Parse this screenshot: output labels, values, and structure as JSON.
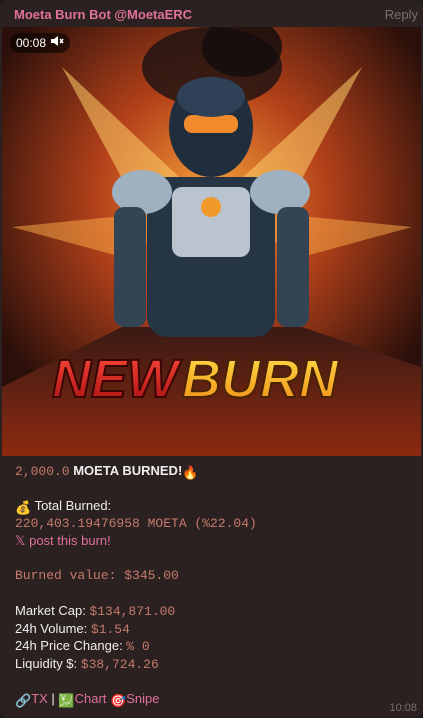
{
  "header": {
    "sender": "Moeta Burn Bot @MoetaERC",
    "reply_label": "Reply"
  },
  "video": {
    "timestamp": "00:08",
    "banner_text": "NEW BURN",
    "muted": true
  },
  "message": {
    "burn_amount": "2,000.0",
    "burn_headline": " MOETA BURNED!",
    "total_burned_label": " Total Burned:",
    "total_burned_value": "220,403.19476958 MOETA (%22.04)",
    "x_post_label": "𝕏 post this burn!",
    "burned_value": "Burned value: $345.00",
    "stats": [
      {
        "label": "Market Cap: ",
        "value": "$134,871.00"
      },
      {
        "label": "24h Volume: ",
        "value": "$1.54"
      },
      {
        "label": "24h Price Change: ",
        "value": "% 0"
      },
      {
        "label": "Liquidity $: ",
        "value": "$38,724.26"
      }
    ],
    "links": {
      "tx": "TX",
      "sep": " | ",
      "chart": "Chart",
      "snipe": "Snipe"
    },
    "time": "10:08"
  },
  "colors": {
    "sender": "#e0719a",
    "mono": "#c47a6c",
    "background": "#2b2120"
  },
  "icons": [
    "mute-icon",
    "money-bag-icon",
    "fire-icon",
    "link-icon",
    "chart-icon",
    "target-icon"
  ]
}
